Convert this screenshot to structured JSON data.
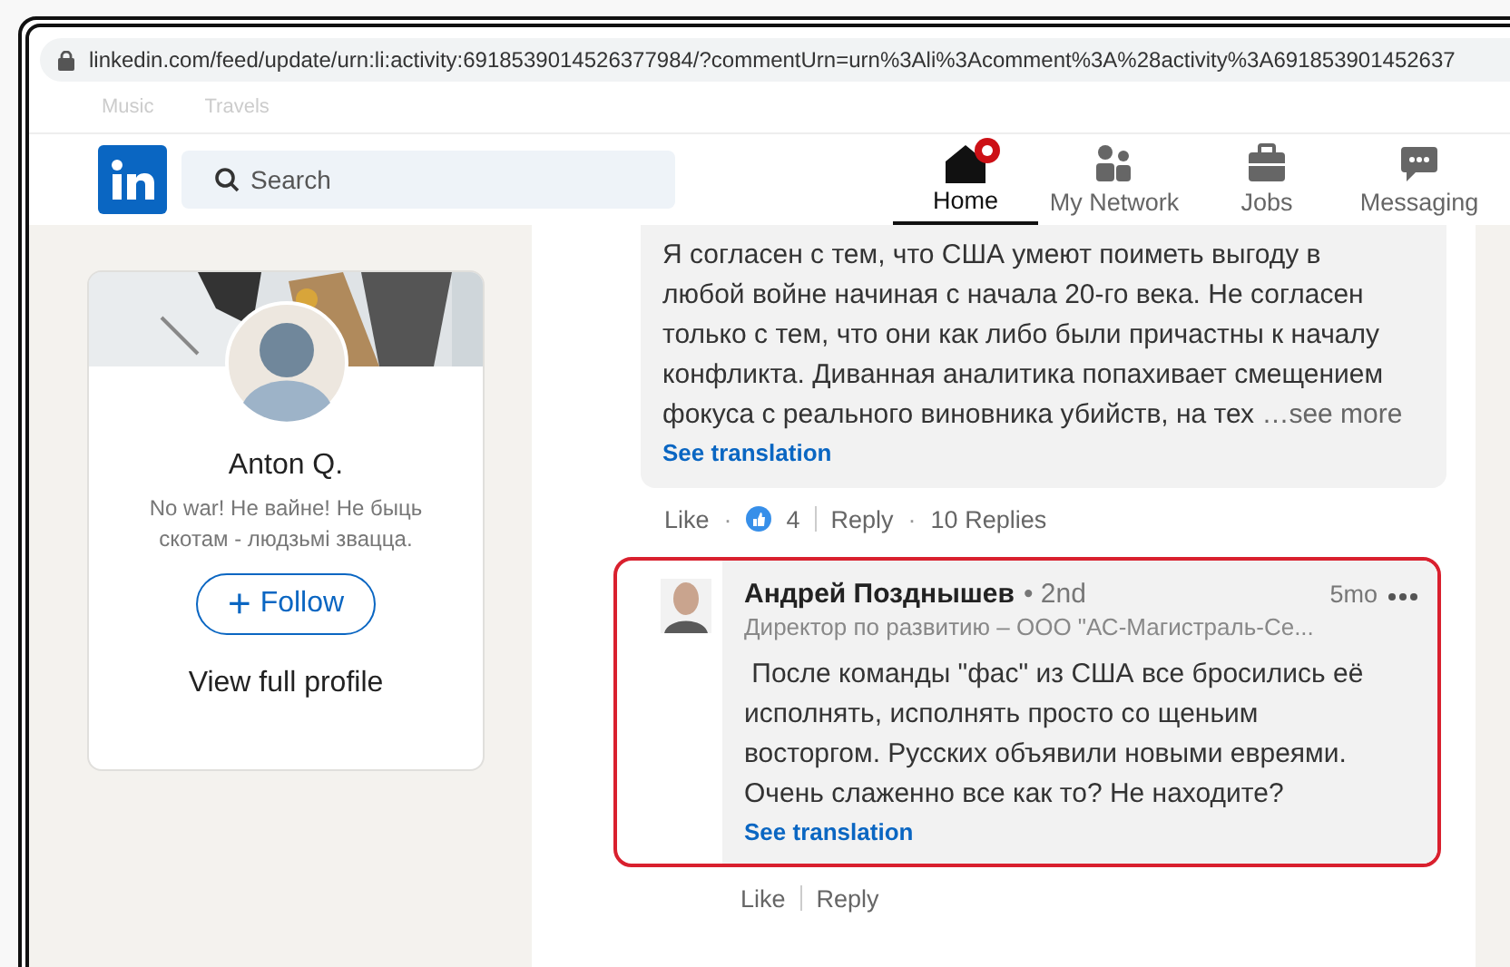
{
  "browser": {
    "url": "linkedin.com/feed/update/urn:li:activity:6918539014526377984/?commentUrn=urn%3Ali%3Acomment%3A%28activity%3A691853901452637",
    "bookmarks": [
      "Music",
      "Travels"
    ]
  },
  "nav": {
    "search": {
      "placeholder": "Search"
    },
    "items": [
      {
        "label": "Home",
        "selected": true,
        "badge": true
      },
      {
        "label": "My Network",
        "selected": false,
        "badge": false
      },
      {
        "label": "Jobs",
        "selected": false,
        "badge": false
      },
      {
        "label": "Messaging",
        "selected": false,
        "badge": false
      }
    ]
  },
  "profile": {
    "name": "Anton Q.",
    "headline": "No war! Не вайне! Не быць скотам - людзьмі звацца.",
    "follow": "Follow",
    "follow_icon": "+",
    "view": "View full profile"
  },
  "comments": [
    {
      "text": "Я согласен с тем, что США умеют поиметь выгоду в любой войне начиная с начала 20-го века. Не согласен только с тем, что они как либо были причастны к началу конфликта. Диванная аналитика попахивает смещением фокуса с реального виновника убийств, на тех",
      "see_more": "…see more",
      "translation": "See translation",
      "actions": {
        "like": "Like",
        "reactions": "4",
        "reply": "Reply",
        "replies": "10 Replies",
        "separator": "·"
      }
    },
    {
      "author": "Андрей Позднышев",
      "degree": "• 2nd",
      "subtitle": "Директор по развитию – ООО \"АС-Магистраль-Се...",
      "time": "5mo",
      "text": " После команды \"фас\" из США все бросились её исполнять, исполнять просто со щеньим восторгом. Русских объявили новыми евреями. Очень слаженно все как то? Не находите?",
      "translation": "See translation",
      "actions": {
        "like": "Like",
        "reply": "Reply"
      },
      "highlighted": true
    }
  ]
}
